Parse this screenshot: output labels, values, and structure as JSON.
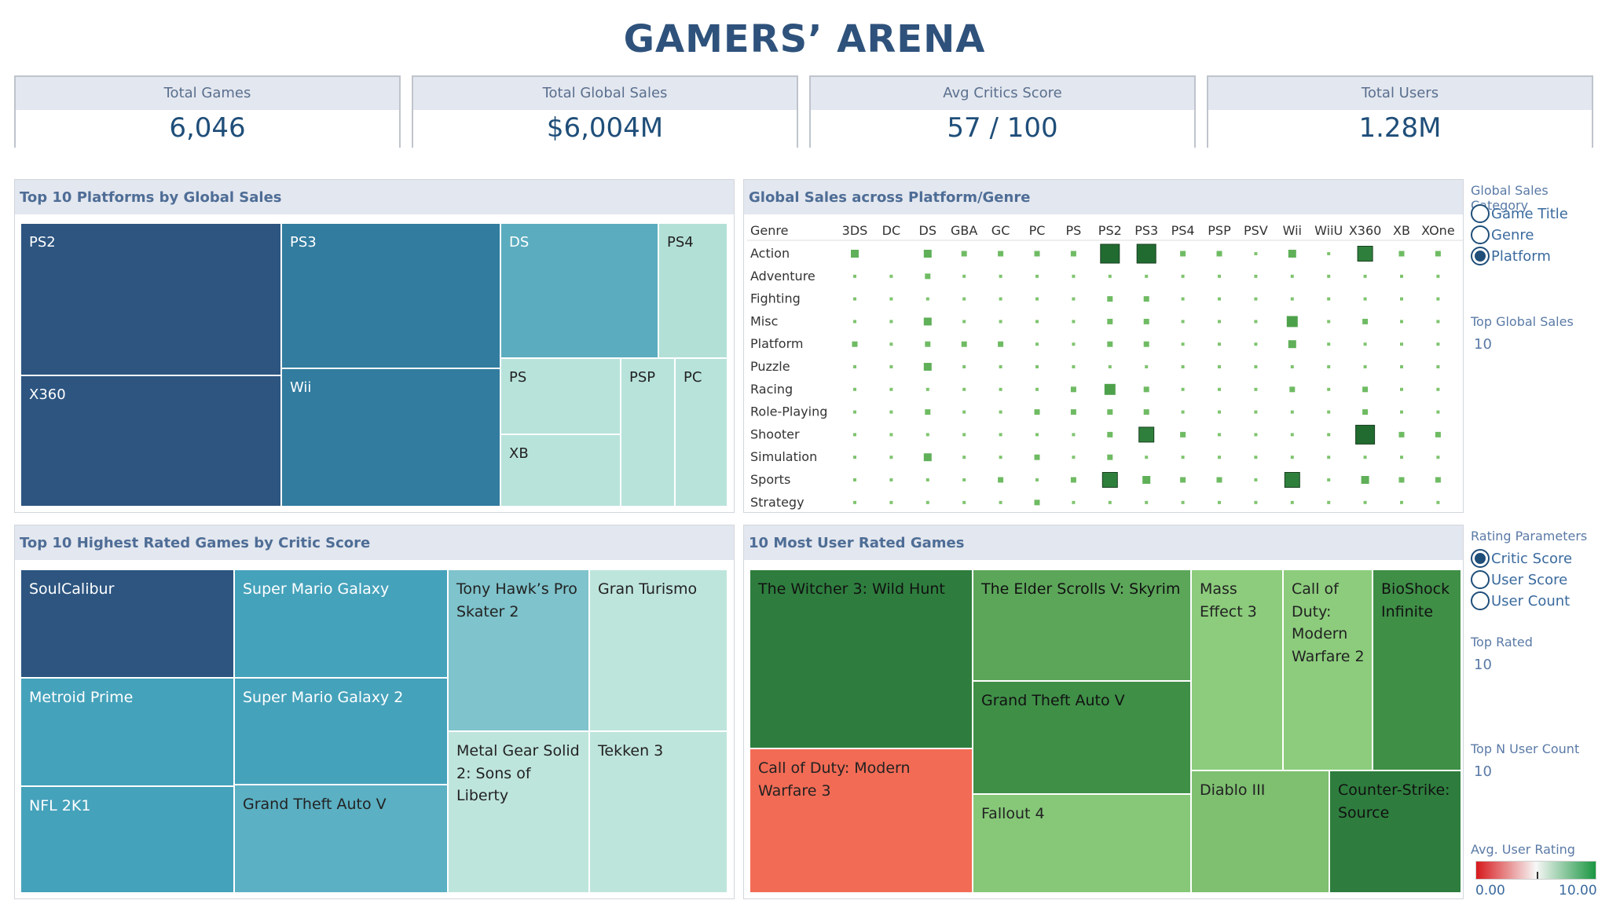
{
  "title": "GAMERS’ ARENA",
  "kpis": [
    {
      "label": "Total Games",
      "value": "6,046"
    },
    {
      "label": "Total Global Sales",
      "value": "$6,004M"
    },
    {
      "label": "Avg Critics Score",
      "value": "57 / 100"
    },
    {
      "label": "Total Users",
      "value": "1.28M"
    }
  ],
  "panels": {
    "platforms": "Top 10 Platforms by Global Sales",
    "heatmap": "Global Sales across Platform/Genre",
    "critic": "Top 10 Highest Rated Games by Critic Score",
    "user": "10 Most User Rated Games"
  },
  "controls": {
    "sales_category": {
      "label": "Global Sales Category",
      "options": [
        "Game Title",
        "Genre",
        "Platform"
      ],
      "selected": "Platform"
    },
    "top_global_sales": {
      "label": "Top Global Sales",
      "value": "10"
    },
    "rating_parameters": {
      "label": "Rating Parameters",
      "options": [
        "Critic Score",
        "User Score",
        "User Count"
      ],
      "selected": "Critic Score"
    },
    "top_rated": {
      "label": "Top Rated",
      "value": "10"
    },
    "top_n_user_count": {
      "label": "Top N User Count",
      "value": "10"
    },
    "legend": {
      "label": "Avg. User Rating",
      "min": "0.00",
      "max": "10.00",
      "low_color": "#d7191c",
      "mid_color": "#f7f7f7",
      "high_color": "#1a9641"
    }
  },
  "colors": {
    "accent": "#2e527b",
    "kpi_value": "#1f4e79",
    "header_bg": "#e3e7ef"
  },
  "chart_data": [
    {
      "type": "treemap",
      "id": "platforms",
      "items": [
        {
          "label": "PS2",
          "color": "#2d5580"
        },
        {
          "label": "X360",
          "color": "#2d5580"
        },
        {
          "label": "PS3",
          "color": "#327c9f"
        },
        {
          "label": "Wii",
          "color": "#327c9f"
        },
        {
          "label": "DS",
          "color": "#5bacbf"
        },
        {
          "label": "PS4",
          "color": "#b2e0d6"
        },
        {
          "label": "PS",
          "color": "#b8e3db"
        },
        {
          "label": "XB",
          "color": "#b8e3db"
        },
        {
          "label": "PSP",
          "color": "#b8e3db"
        },
        {
          "label": "PC",
          "color": "#b8e3db"
        }
      ]
    },
    {
      "type": "heatmap",
      "id": "heatmap",
      "row_header": "Genre",
      "columns": [
        "3DS",
        "DC",
        "DS",
        "GBA",
        "GC",
        "PC",
        "PS",
        "PS2",
        "PS3",
        "PS4",
        "PSP",
        "PSV",
        "Wii",
        "WiiU",
        "X360",
        "XB",
        "XOne"
      ],
      "rows": [
        "Action",
        "Adventure",
        "Fighting",
        "Misc",
        "Platform",
        "Puzzle",
        "Racing",
        "Role-Playing",
        "Shooter",
        "Simulation",
        "Sports",
        "Strategy"
      ],
      "values": [
        [
          3,
          0,
          3,
          2,
          2,
          2,
          2,
          6,
          6,
          2,
          2,
          1,
          3,
          1,
          5,
          2,
          2
        ],
        [
          1,
          1,
          2,
          1,
          1,
          1,
          1,
          1,
          1,
          1,
          1,
          1,
          1,
          1,
          1,
          1,
          1
        ],
        [
          1,
          1,
          1,
          1,
          1,
          1,
          1,
          2,
          2,
          1,
          1,
          1,
          1,
          1,
          1,
          1,
          1
        ],
        [
          1,
          1,
          3,
          1,
          1,
          1,
          1,
          2,
          2,
          1,
          1,
          1,
          4,
          1,
          2,
          1,
          1
        ],
        [
          2,
          1,
          2,
          2,
          2,
          1,
          1,
          2,
          2,
          1,
          1,
          1,
          3,
          1,
          1,
          1,
          1
        ],
        [
          1,
          1,
          3,
          1,
          1,
          1,
          1,
          1,
          1,
          1,
          1,
          1,
          1,
          1,
          1,
          1,
          1
        ],
        [
          1,
          1,
          1,
          1,
          1,
          1,
          2,
          4,
          2,
          1,
          1,
          1,
          2,
          1,
          2,
          1,
          1
        ],
        [
          1,
          1,
          2,
          1,
          1,
          2,
          2,
          2,
          2,
          1,
          1,
          1,
          1,
          1,
          2,
          1,
          1
        ],
        [
          1,
          1,
          1,
          1,
          1,
          1,
          1,
          2,
          5,
          2,
          1,
          1,
          1,
          1,
          6,
          2,
          2
        ],
        [
          1,
          1,
          3,
          1,
          1,
          2,
          1,
          2,
          1,
          1,
          1,
          1,
          1,
          1,
          1,
          1,
          1
        ],
        [
          1,
          1,
          1,
          1,
          2,
          1,
          2,
          5,
          3,
          2,
          2,
          1,
          5,
          1,
          3,
          2,
          2
        ],
        [
          1,
          1,
          1,
          1,
          1,
          2,
          1,
          1,
          1,
          1,
          1,
          1,
          1,
          1,
          1,
          1,
          1
        ]
      ]
    },
    {
      "type": "treemap",
      "id": "critic",
      "items": [
        {
          "label": "SoulCalibur",
          "color": "#2d5580"
        },
        {
          "label": "Metroid Prime",
          "color": "#45a2bb"
        },
        {
          "label": "NFL 2K1",
          "color": "#45a2bb"
        },
        {
          "label": "Super Mario Galaxy",
          "color": "#45a2bb"
        },
        {
          "label": "Super Mario Galaxy 2",
          "color": "#45a2bb"
        },
        {
          "label": "Grand Theft Auto V",
          "color": "#5bb0c3"
        },
        {
          "label": "Tony Hawk’s Pro Skater 2",
          "color": "#7fc3cc"
        },
        {
          "label": "Metal Gear Solid 2: Sons of Liberty",
          "color": "#bee5dc"
        },
        {
          "label": "Gran Turismo",
          "color": "#bee5dc"
        },
        {
          "label": "Tekken 3",
          "color": "#bee5dc"
        }
      ]
    },
    {
      "type": "treemap",
      "id": "user",
      "items": [
        {
          "label": "The Witcher 3: Wild Hunt",
          "color": "#2e7d3e"
        },
        {
          "label": "Call of Duty: Modern Warfare 3",
          "color": "#f26b55"
        },
        {
          "label": "The Elder Scrolls V: Skyrim",
          "color": "#5ca65a"
        },
        {
          "label": "Grand Theft Auto V",
          "color": "#3f8f47"
        },
        {
          "label": "Fallout 4",
          "color": "#86c878"
        },
        {
          "label": "Mass Effect 3",
          "color": "#8ccc7c"
        },
        {
          "label": "Call of Duty: Modern Warfare 2",
          "color": "#8ccc7c"
        },
        {
          "label": "BioShock Infinite",
          "color": "#3f8f47"
        },
        {
          "label": "Diablo III",
          "color": "#7ebf70"
        },
        {
          "label": "Counter-Strike: Source",
          "color": "#2e7d3e"
        }
      ]
    }
  ]
}
